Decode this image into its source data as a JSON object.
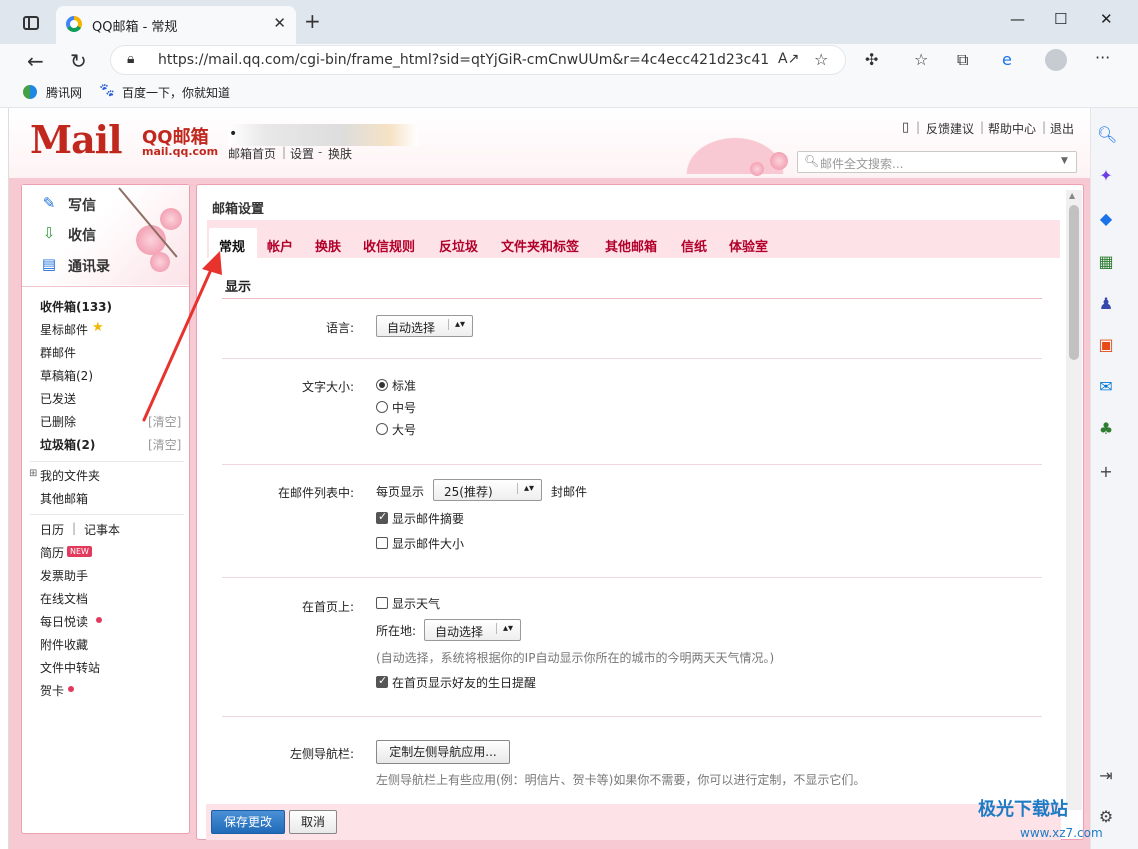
{
  "browser": {
    "tab_title": "QQ邮箱 - 常规",
    "url": "https://mail.qq.com/cgi-bin/frame_html?sid=qtYjGiR-cmCnwUUm&r=4c4ecc421d23c418b533cb...",
    "bookmarks": [
      "腾讯网",
      "百度一下，你就知道"
    ]
  },
  "header": {
    "logo": "Mail",
    "brand": "QQ邮箱",
    "brand_url": "mail.qq.com",
    "account_dot": "•",
    "links": [
      "邮箱首页",
      "设置",
      "换肤"
    ],
    "top_links": [
      "反馈建议",
      "帮助中心",
      "退出"
    ],
    "search_placeholder": "邮件全文搜索..."
  },
  "sidebar": {
    "write": "写信",
    "receive": "收信",
    "contacts": "通讯录",
    "folders": [
      {
        "label": "收件箱(133)"
      },
      {
        "label": "星标邮件"
      },
      {
        "label": "群邮件"
      },
      {
        "label": "草稿箱(2)"
      },
      {
        "label": "已发送"
      },
      {
        "label": "已删除",
        "action": "[清空]"
      },
      {
        "label": "垃圾箱(2)",
        "action": "[清空]"
      }
    ],
    "my_folders": "我的文件夹",
    "other_mail": "其他邮箱",
    "calendar": "日历",
    "notes": "记事本",
    "apps": [
      {
        "label": "简历",
        "badge": "NEW"
      },
      {
        "label": "发票助手"
      },
      {
        "label": "在线文档"
      },
      {
        "label": "每日悦读"
      },
      {
        "label": "附件收藏"
      },
      {
        "label": "文件中转站"
      },
      {
        "label": "贺卡"
      }
    ]
  },
  "settings": {
    "title": "邮箱设置",
    "tabs": [
      "常规",
      "帐户",
      "换肤",
      "收信规则",
      "反垃圾",
      "文件夹和标签",
      "其他邮箱",
      "信纸",
      "体验室"
    ],
    "section": "显示",
    "language_label": "语言:",
    "language_value": "自动选择",
    "fontsize_label": "文字大小:",
    "fontsize_options": [
      "标准",
      "中号",
      "大号"
    ],
    "list_label": "在邮件列表中:",
    "per_page_prefix": "每页显示",
    "per_page_value": "25(推荐)",
    "per_page_suffix": "封邮件",
    "show_summary": "显示邮件摘要",
    "show_size": "显示邮件大小",
    "home_label": "在首页上:",
    "show_weather": "显示天气",
    "location_label": "所在地:",
    "location_value": "自动选择",
    "weather_hint": "(自动选择，系统将根据你的IP自动显示你所在的城市的今明两天天气情况。)",
    "birthday": "在首页显示好友的生日提醒",
    "leftnav_label": "左侧导航栏:",
    "leftnav_button": "定制左侧导航应用...",
    "leftnav_hint": "左侧导航栏上有些应用(例：明信片、贺卡等)如果你不需要，你可以进行定制，不显示它们。",
    "save": "保存更改",
    "cancel": "取消"
  },
  "watermark": {
    "brand": "极光下载站",
    "url": "www.xz7.com"
  }
}
